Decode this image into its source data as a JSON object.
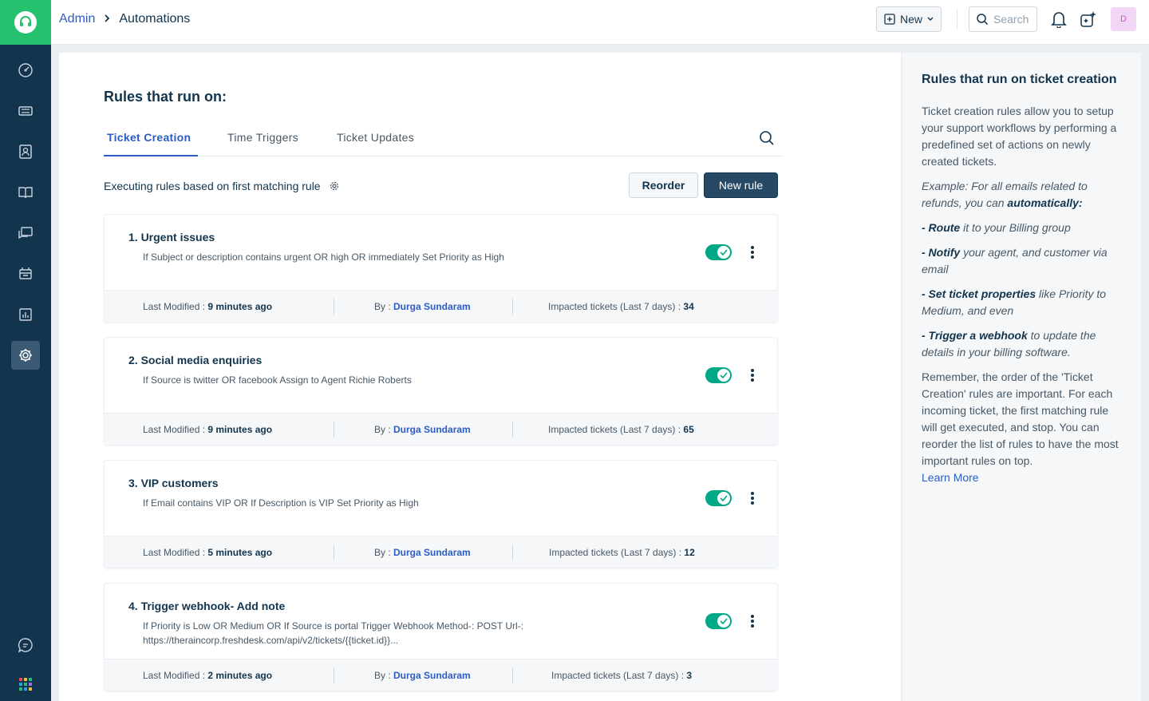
{
  "header": {
    "breadcrumb_root": "Admin",
    "breadcrumb_current": "Automations",
    "new_label": "New",
    "search_placeholder": "Search",
    "avatar_initial": "D"
  },
  "main": {
    "title": "Rules that run on:",
    "tabs": [
      {
        "label": "Ticket Creation",
        "active": true
      },
      {
        "label": "Time Triggers",
        "active": false
      },
      {
        "label": "Ticket Updates",
        "active": false
      }
    ],
    "exec_text": "Executing rules based on first matching rule",
    "reorder_label": "Reorder",
    "new_rule_label": "New rule"
  },
  "rules": [
    {
      "title": "1.  Urgent issues",
      "desc": "If Subject or description contains urgent OR high OR immediately Set Priority as High",
      "modified_label": "Last Modified : ",
      "modified_value": "9 minutes ago",
      "by_label": "By : ",
      "by_value": "Durga Sundaram",
      "impacted_label": "Impacted tickets (Last 7 days) : ",
      "impacted_value": "34",
      "enabled": true
    },
    {
      "title": "2.  Social media enquiries",
      "desc": "If Source is twitter OR facebook Assign to Agent Richie Roberts",
      "modified_label": "Last Modified : ",
      "modified_value": "9 minutes ago",
      "by_label": "By : ",
      "by_value": "Durga Sundaram",
      "impacted_label": "Impacted tickets (Last 7 days) : ",
      "impacted_value": "65",
      "enabled": true
    },
    {
      "title": "3.  VIP customers",
      "desc": "If Email contains VIP OR If Description is VIP Set Priority as High",
      "modified_label": "Last Modified : ",
      "modified_value": "5 minutes ago",
      "by_label": "By : ",
      "by_value": "Durga Sundaram",
      "impacted_label": "Impacted tickets (Last 7 days) : ",
      "impacted_value": "12",
      "enabled": true
    },
    {
      "title": "4.  Trigger webhook- Add note",
      "desc": "If Priority is Low OR Medium OR If Source is portal Trigger Webhook Method-: POST Url-: https://theraincorp.freshdesk.com/api/v2/tickets/{{ticket.id}}...",
      "modified_label": "Last Modified : ",
      "modified_value": "2 minutes ago",
      "by_label": "By : ",
      "by_value": "Durga Sundaram",
      "impacted_label": "Impacted tickets (Last 7 days) : ",
      "impacted_value": "3",
      "enabled": true
    }
  ],
  "side_panel": {
    "title": "Rules that run on ticket creation",
    "intro": "Ticket creation rules allow you to setup your support workflows by performing a predefined set of actions on newly created tickets.",
    "example_prefix": "Example: For all emails related to refunds, you can ",
    "example_bold": "automatically:",
    "b1_bold": "- Route",
    "b1_text": " it to your Billing group",
    "b2_bold": "- Notify",
    "b2_text": " your agent, and customer via email",
    "b3_bold": "- Set ticket properties",
    "b3_text": " like Priority to Medium, and even",
    "b4_bold": "- Trigger a webhook",
    "b4_text": " to update the details in your billing software.",
    "remember": "Remember, the order of the 'Ticket Creation' rules are important. For each incoming ticket, the first matching rule will get executed, and stop. You can reorder the list of rules to have the most important rules on top.",
    "learn_more": "Learn More"
  },
  "colors": {
    "sidebar": "#12344d",
    "brand_green": "#25c16f",
    "link_blue": "#2c5cc5",
    "toggle_on": "#00a886"
  }
}
